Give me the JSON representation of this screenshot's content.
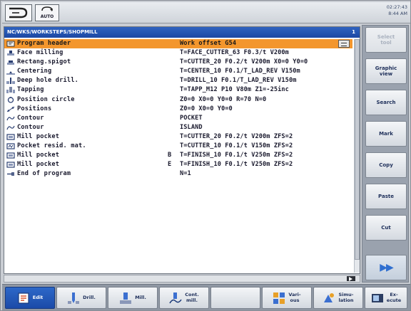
{
  "status": {
    "mode_icon": "jog-mode-icon",
    "auto_label": "AUTO",
    "clock_line1": "02:27:43",
    "clock_line2": "8:44 AM"
  },
  "editor": {
    "path": "NC/WKS/WORKSTEPS/SHOPMILL",
    "channel_num": "1",
    "rows": [
      {
        "icon": "program-header-icon",
        "name": "Program header",
        "tag": "",
        "value": "Work offset G54",
        "selected": true
      },
      {
        "icon": "face-milling-icon",
        "name": "Face milling",
        "tag": "",
        "value": "T=FACE_CUTTER_63 F0.3/t V200m"
      },
      {
        "icon": "rect-spigot-icon",
        "name": "Rectang.spigot",
        "tag": "",
        "value": "T=CUTTER_20 F0.2/t V200m X0=0 Y0=0"
      },
      {
        "icon": "centering-icon",
        "name": "Centering",
        "tag": "",
        "value": "T=CENTER_10 F0.1/T_LAD_REV V150m"
      },
      {
        "icon": "deep-hole-drill-icon",
        "name": "Deep hole drill.",
        "tag": "",
        "value": "T=DRILL_10 F0.1/T_LAD_REV V150m"
      },
      {
        "icon": "tapping-icon",
        "name": "Tapping",
        "tag": "",
        "value": "T=TAPP_M12 P10 V80m Z1=-25inc"
      },
      {
        "icon": "position-circle-icon",
        "name": "Position circle",
        "tag": "",
        "value": "Z0=0 X0=0 Y0=0 R=70 N=0"
      },
      {
        "icon": "positions-icon",
        "name": "Positions",
        "tag": "",
        "value": "Z0=0 X0=0 Y0=0"
      },
      {
        "icon": "contour-icon",
        "name": "Contour",
        "tag": "",
        "value": "POCKET"
      },
      {
        "icon": "contour-icon",
        "name": "Contour",
        "tag": "",
        "value": "ISLAND"
      },
      {
        "icon": "mill-pocket-icon",
        "name": "Mill pocket",
        "tag": "",
        "value": "T=CUTTER_20 F0.2/t V200m ZFS=2"
      },
      {
        "icon": "pocket-resid-icon",
        "name": "Pocket resid. mat.",
        "tag": "",
        "value": "T=CUTTER_10 F0.1/t V150m ZFS=2"
      },
      {
        "icon": "mill-pocket-icon",
        "name": "Mill pocket",
        "tag": "B",
        "value": "T=FINISH_10 F0.1/t V250m ZFS=2"
      },
      {
        "icon": "mill-pocket-icon",
        "name": "Mill pocket",
        "tag": "E",
        "value": "T=FINISH_10 F0.1/t V250m ZFS=2"
      },
      {
        "icon": "end-program-icon",
        "name": "End of program",
        "tag": "",
        "value": "N=1"
      }
    ]
  },
  "vertical_softkeys": [
    {
      "id": "select-tool",
      "label": "Select\ntool",
      "enabled": false
    },
    {
      "id": "graphic-view",
      "label": "Graphic\nview",
      "enabled": true
    },
    {
      "id": "search",
      "label": "Search",
      "enabled": true
    },
    {
      "id": "mark",
      "label": "Mark",
      "enabled": true
    },
    {
      "id": "copy",
      "label": "Copy",
      "enabled": true
    },
    {
      "id": "paste",
      "label": "Paste",
      "enabled": true
    },
    {
      "id": "cut",
      "label": "Cut",
      "enabled": true
    },
    {
      "id": "more",
      "label": "▶▶",
      "enabled": true
    }
  ],
  "horizontal_softkeys": [
    {
      "id": "edit",
      "label": "Edit",
      "icon": "edit-icon",
      "active": true
    },
    {
      "id": "drill",
      "label": "Drill.",
      "icon": "drill-icon"
    },
    {
      "id": "mill",
      "label": "Mill.",
      "icon": "mill-icon"
    },
    {
      "id": "cont-mill",
      "label": "Cont.\nmill.",
      "icon": "contour-mill-icon"
    },
    {
      "id": "blank",
      "label": "",
      "icon": ""
    },
    {
      "id": "various",
      "label": "Vari-\nous",
      "icon": "various-icon"
    },
    {
      "id": "simulation",
      "label": "Simu-\nlation",
      "icon": "simulation-icon"
    },
    {
      "id": "execute",
      "label": "Ex-\necute",
      "icon": "execute-icon"
    }
  ],
  "colors": {
    "selection": "#f3962d",
    "header_blue": "#1c48a3",
    "text_dark": "#1a1a2e"
  }
}
